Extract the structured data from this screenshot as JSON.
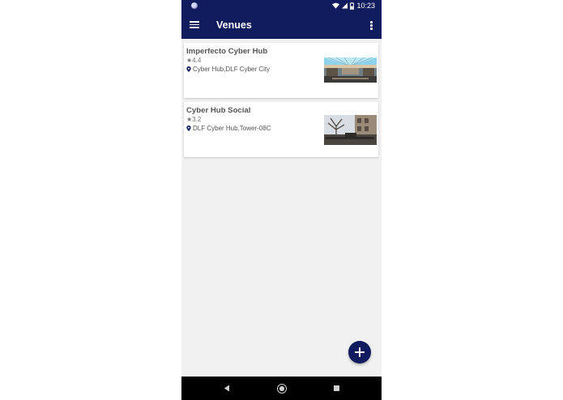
{
  "status_bar": {
    "time": "10:23",
    "icons": [
      "notification-dot-icon",
      "wifi-icon",
      "signal-icon",
      "battery-icon"
    ]
  },
  "app_bar": {
    "title": "Venues",
    "icons": [
      "menu-icon",
      "more-vert-icon"
    ]
  },
  "venues": [
    {
      "name": "Imperfecto Cyber Hub",
      "rating": "4.4",
      "location": "Cyber Hub,DLF Cyber City"
    },
    {
      "name": "Cyber Hub Social",
      "rating": "3.2",
      "location": "DLF Cyber Hub,Tower-08C"
    }
  ],
  "fab": {
    "icon": "add-icon"
  },
  "nav_bar": {
    "icons": [
      "back-icon",
      "home-icon",
      "recents-icon"
    ]
  },
  "colors": {
    "primary": "#111c5e",
    "background": "#f1f1f1",
    "card": "#ffffff"
  }
}
